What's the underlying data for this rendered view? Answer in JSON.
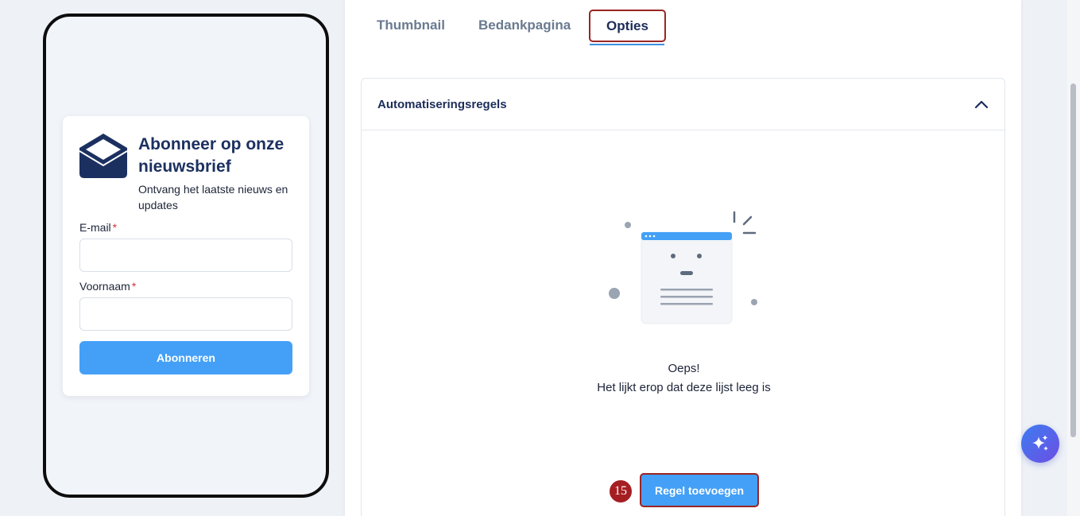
{
  "preview": {
    "form": {
      "title": "Abonneer op onze nieuwsbrief",
      "subtitle": "Ontvang het laatste nieuws en updates",
      "email_label": "E-mail",
      "firstname_label": "Voornaam",
      "required_mark": "*",
      "submit_label": "Abonneren",
      "icon": "envelope-open-icon"
    }
  },
  "tabs": [
    {
      "label": "Thumbnail",
      "active": false
    },
    {
      "label": "Bedankpagina",
      "active": false
    },
    {
      "label": "Opties",
      "active": true
    }
  ],
  "automation": {
    "title": "Automatiseringsregels",
    "expanded": true,
    "empty_title": "Oeps!",
    "empty_subtitle": "Het lijkt erop dat deze lijst leeg is",
    "add_button_label": "Regel toevoegen",
    "step_badge": "15"
  },
  "ai_button": {
    "icon": "sparkles-icon"
  },
  "colors": {
    "primary": "#44a0f7",
    "highlight_border": "#9b2424",
    "heading": "#1c2d5a",
    "badge": "#a51e22"
  }
}
